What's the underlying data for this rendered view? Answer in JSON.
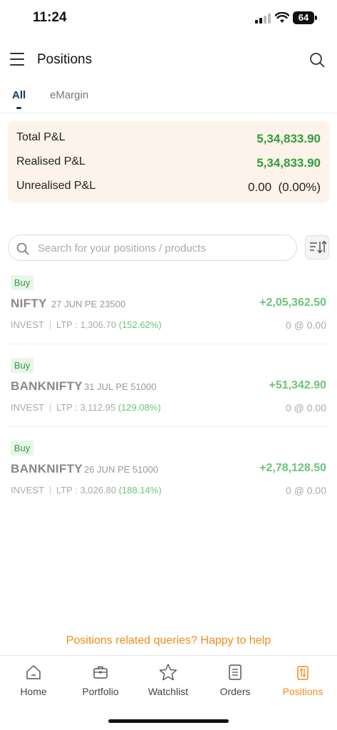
{
  "status_bar": {
    "time": "11:24",
    "battery": "64"
  },
  "header": {
    "title": "Positions"
  },
  "tabs": [
    {
      "label": "All"
    },
    {
      "label": "eMargin"
    }
  ],
  "summary": {
    "total_label": "Total P&L",
    "total_value": "5,34,833.90",
    "realised_label": "Realised P&L",
    "realised_value": "5,34,833.90",
    "unrealised_label": "Unrealised P&L",
    "unrealised_value": "0.00  (0.00%)"
  },
  "search": {
    "placeholder": "Search for your positions / products"
  },
  "positions": [
    {
      "badge": "Buy",
      "symbol": "NIFTY",
      "contract": "27 JUN PE 23500",
      "pnl": "+2,05,362.50",
      "product": "INVEST",
      "ltp": "LTP : 1,306.70",
      "change": "(152.62%)",
      "qty": "0 @ 0.00"
    },
    {
      "badge": "Buy",
      "symbol": "BANKNIFTY",
      "contract": "31 JUL PE 51000",
      "pnl": "+51,342.90",
      "product": "INVEST",
      "ltp": "LTP : 3,112.95",
      "change": "(129.08%)",
      "qty": "0 @ 0.00"
    },
    {
      "badge": "Buy",
      "symbol": "BANKNIFTY",
      "contract": "26 JUN PE 51000",
      "pnl": "+2,78,128.50",
      "product": "INVEST",
      "ltp": "LTP : 3,026.80",
      "change": "(188.14%)",
      "qty": "0 @ 0.00"
    }
  ],
  "help": {
    "text": "Positions related queries? Happy to help"
  },
  "bottom_nav": [
    {
      "label": "Home",
      "icon": "home-icon"
    },
    {
      "label": "Portfolio",
      "icon": "briefcase-icon"
    },
    {
      "label": "Watchlist",
      "icon": "star-icon"
    },
    {
      "label": "Orders",
      "icon": "orders-list-icon"
    },
    {
      "label": "Positions",
      "icon": "positions-icon",
      "active": true
    }
  ],
  "colors": {
    "accent": "#f08c1a",
    "profit": "#2e9e3f",
    "tab_active": "#0d3b66",
    "summary_bg": "#fdf3ea"
  }
}
